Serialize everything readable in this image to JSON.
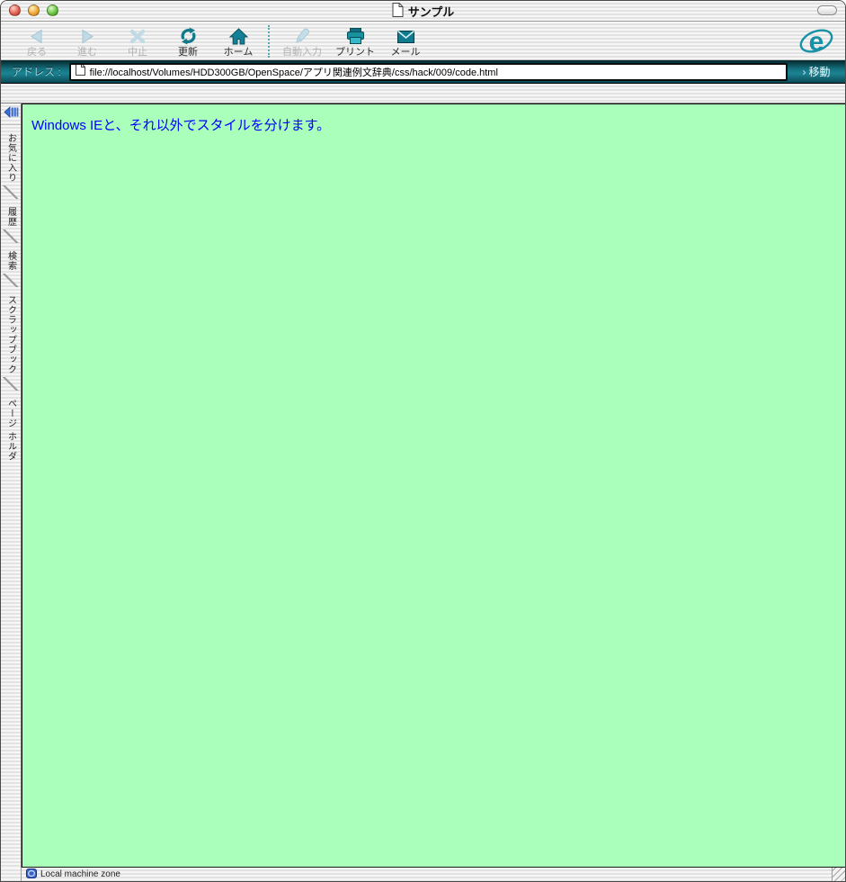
{
  "window": {
    "title": "サンプル",
    "title_icon": "document-icon",
    "controls": [
      "close-button",
      "minimize-button",
      "zoom-button"
    ],
    "toolbar_toggle": "toolbar-collapse-pill"
  },
  "toolbar": {
    "buttons": [
      {
        "label": "戻る",
        "icon": "back-arrow-icon",
        "enabled": false
      },
      {
        "label": "進む",
        "icon": "forward-arrow-icon",
        "enabled": false
      },
      {
        "label": "中止",
        "icon": "stop-x-icon",
        "enabled": false
      },
      {
        "label": "更新",
        "icon": "refresh-icon",
        "enabled": true
      },
      {
        "label": "ホーム",
        "icon": "home-icon",
        "enabled": true
      },
      {
        "label": "自動入力",
        "icon": "autofill-icon",
        "enabled": false
      },
      {
        "label": "プリント",
        "icon": "print-icon",
        "enabled": true
      },
      {
        "label": "メール",
        "icon": "mail-icon",
        "enabled": true
      }
    ],
    "logo": "ie-logo"
  },
  "address_bar": {
    "label": "アドレス :",
    "url": "file://localhost/Volumes/HDD300GB/OpenSpace/アプリ関連例文辞典/css/hack/009/code.html",
    "go_label": "移動",
    "go_arrow": "›"
  },
  "sidebar": {
    "collapse_icon": "hide-panel-icon",
    "tabs": [
      {
        "label": "お気に入り"
      },
      {
        "label": "履歴"
      },
      {
        "label": "検索"
      },
      {
        "label": "スクラップブック"
      },
      {
        "label": "ページ ホルダ"
      }
    ]
  },
  "content": {
    "text": "Windows IEと、それ以外でスタイルを分けます。",
    "background": "#aaffbb",
    "text_color": "#0000ff"
  },
  "status_bar": {
    "zone_icon": "security-zone-icon",
    "zone_label": "Local machine zone"
  },
  "colors": {
    "accent_teal": "#16808f",
    "address_bar_teal": "#14707d",
    "disabled_icon_blue": "#c0dbe6"
  }
}
